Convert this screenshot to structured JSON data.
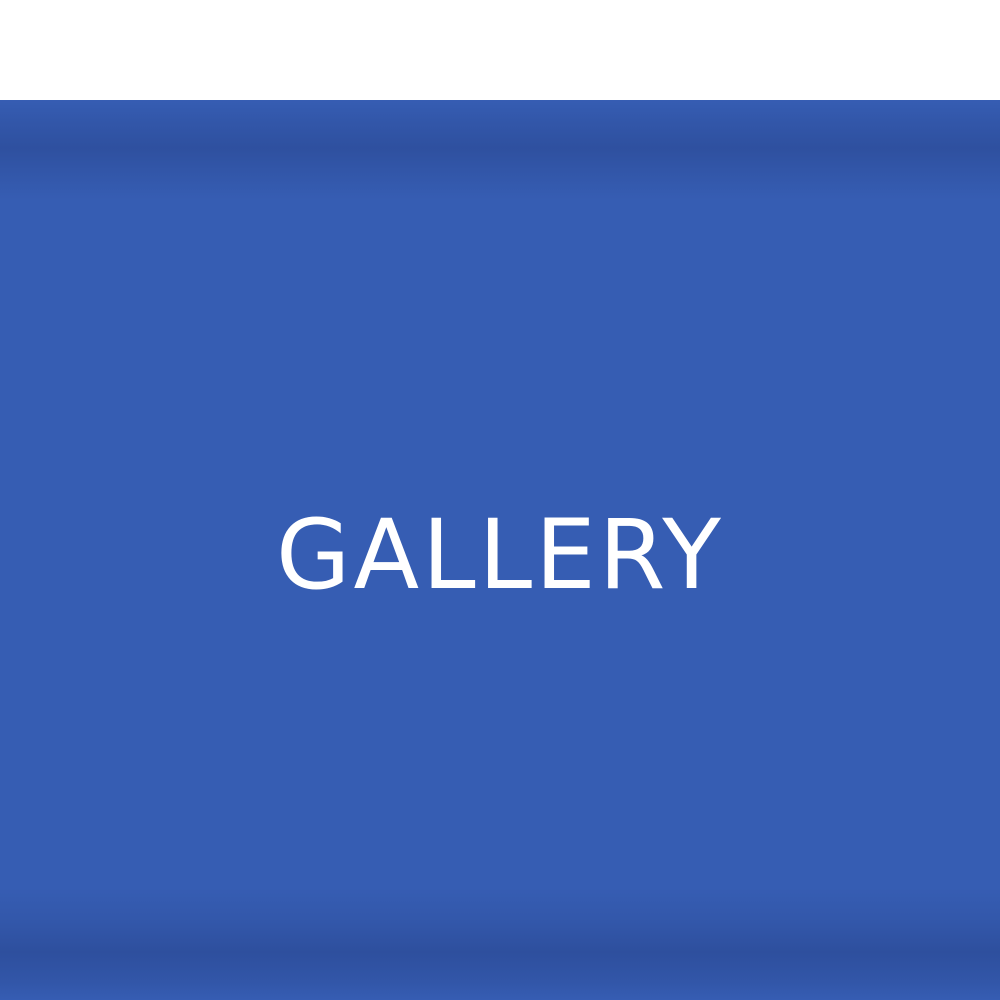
{
  "banner": {
    "label": "GALLERY",
    "background_color": "#365db3",
    "text_color": "#ffffff"
  },
  "page": {
    "background_color": "#ffffff"
  }
}
